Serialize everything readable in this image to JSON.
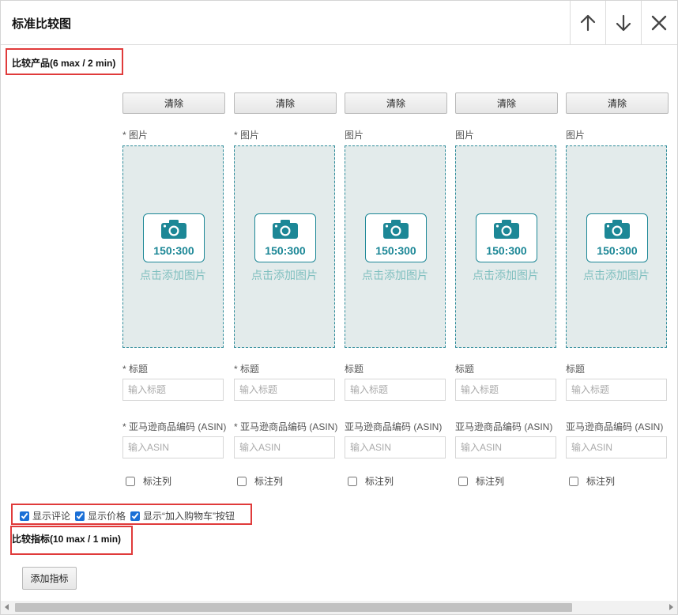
{
  "header": {
    "title": "标准比较图",
    "up_icon": "arrow-up-icon",
    "down_icon": "arrow-down-icon",
    "close_icon": "close-icon"
  },
  "products_section": {
    "title": "比较产品(6 max / 2 min)"
  },
  "columns": [
    {
      "clear_label": "清除",
      "image_label": "* 图片",
      "image_ratio": "150:300",
      "image_hint": "点击添加图片",
      "title_label": "* 标题",
      "title_placeholder": "输入标题",
      "asin_label": "* 亚马逊商品编码 (ASIN)",
      "asin_placeholder": "输入ASIN",
      "highlight_label": "标注列",
      "highlight_checked": false
    },
    {
      "clear_label": "清除",
      "image_label": "* 图片",
      "image_ratio": "150:300",
      "image_hint": "点击添加图片",
      "title_label": "* 标题",
      "title_placeholder": "输入标题",
      "asin_label": "* 亚马逊商品编码 (ASIN)",
      "asin_placeholder": "输入ASIN",
      "highlight_label": "标注列",
      "highlight_checked": false
    },
    {
      "clear_label": "清除",
      "image_label": "图片",
      "image_ratio": "150:300",
      "image_hint": "点击添加图片",
      "title_label": "标题",
      "title_placeholder": "输入标题",
      "asin_label": "亚马逊商品编码 (ASIN)",
      "asin_placeholder": "输入ASIN",
      "highlight_label": "标注列",
      "highlight_checked": false
    },
    {
      "clear_label": "清除",
      "image_label": "图片",
      "image_ratio": "150:300",
      "image_hint": "点击添加图片",
      "title_label": "标题",
      "title_placeholder": "输入标题",
      "asin_label": "亚马逊商品编码 (ASIN)",
      "asin_placeholder": "输入ASIN",
      "highlight_label": "标注列",
      "highlight_checked": false
    },
    {
      "clear_label": "清除",
      "image_label": "图片",
      "image_ratio": "150:300",
      "image_hint": "点击添加图片",
      "title_label": "标题",
      "title_placeholder": "输入标题",
      "asin_label": "亚马逊商品编码 (ASIN)",
      "asin_placeholder": "输入ASIN",
      "highlight_label": "标注列",
      "highlight_checked": false
    }
  ],
  "options": [
    {
      "label": "显示评论",
      "checked": true
    },
    {
      "label": "显示价格",
      "checked": true
    },
    {
      "label": "显示“加入购物车”按钮",
      "checked": true
    }
  ],
  "metrics_section": {
    "title": "比较指标(10 max / 1 min)",
    "add_label": "添加指标"
  },
  "colors": {
    "accent": "#1c8796",
    "annotation_red": "#e03b3b",
    "image_bg": "#e3ebeb"
  }
}
